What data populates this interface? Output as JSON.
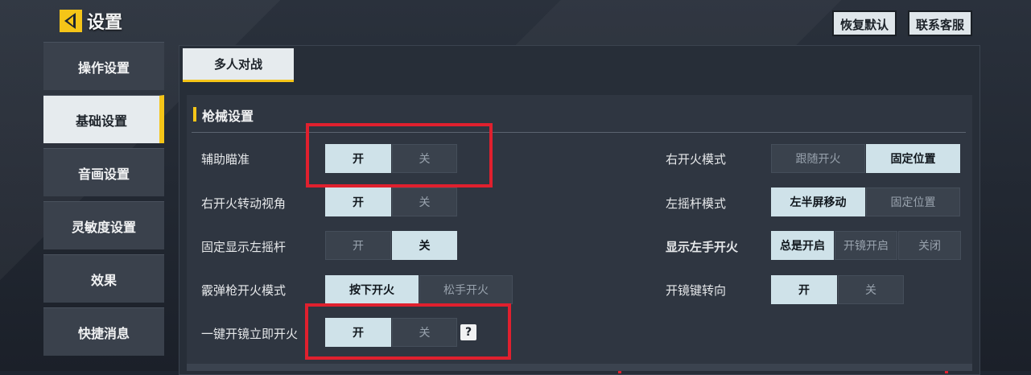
{
  "header": {
    "title": "设置",
    "restore_default": "恢复默认",
    "contact_support": "联系客服"
  },
  "sidebar": {
    "items": [
      {
        "label": "操作设置"
      },
      {
        "label": "基础设置"
      },
      {
        "label": "音画设置"
      },
      {
        "label": "灵敏度设置"
      },
      {
        "label": "效果"
      },
      {
        "label": "快捷消息"
      }
    ],
    "active_index": 1
  },
  "tab": {
    "label": "多人对战"
  },
  "section": {
    "title": "枪械设置"
  },
  "left_settings": [
    {
      "label": "辅助瞄准",
      "options": [
        "开",
        "关"
      ],
      "selected": 0
    },
    {
      "label": "右开火转动视角",
      "options": [
        "开",
        "关"
      ],
      "selected": 0
    },
    {
      "label": "固定显示左摇杆",
      "options": [
        "开",
        "关"
      ],
      "selected": 1
    },
    {
      "label": "霰弹枪开火模式",
      "options": [
        "按下开火",
        "松手开火"
      ],
      "selected": 0
    },
    {
      "label": "一键开镜立即开火",
      "options": [
        "开",
        "关"
      ],
      "selected": 0
    }
  ],
  "right_settings": [
    {
      "label": "右开火模式",
      "options": [
        "跟随开火",
        "固定位置"
      ],
      "selected": 1
    },
    {
      "label": "左摇杆模式",
      "options": [
        "左半屏移动",
        "固定位置"
      ],
      "selected": 0
    },
    {
      "label": "显示左手开火",
      "options": [
        "总是开启",
        "开镜开启",
        "关闭"
      ],
      "selected": 0
    },
    {
      "label": "开镜键转向",
      "options": [
        "开",
        "关"
      ],
      "selected": 0
    }
  ],
  "help_icon": "?",
  "colors": {
    "accent": "#f5c518",
    "highlight_box": "#e0202e",
    "selected_option": "#cfe2e9"
  }
}
